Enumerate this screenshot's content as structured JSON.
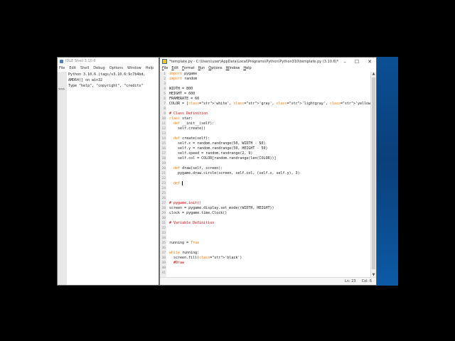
{
  "shell": {
    "title": "IDLE Shell 3.10.6",
    "menu": [
      "File",
      "Edit",
      "Shell",
      "Debug",
      "Options",
      "Window",
      "Help"
    ],
    "output_lines": [
      "Python 3.10.6 (tags/v3.10.6:9c7b4bd,",
      "AMD64)] on win32",
      "Type \"help\", \"copyright\", \"credits\""
    ],
    "prompt": ">>>"
  },
  "editor": {
    "title": "*template.py - C:\\Users\\user\\AppData\\Local\\Programs\\Python\\Python310\\template.py (3.10.6)*",
    "menu": [
      "File",
      "Edit",
      "Format",
      "Run",
      "Options",
      "Window",
      "Help"
    ],
    "window_buttons": [
      "–",
      "☐",
      "✕"
    ],
    "code": [
      {
        "n": "1",
        "t": "import pygame"
      },
      {
        "n": "2",
        "t": "import random"
      },
      {
        "n": "3",
        "t": ""
      },
      {
        "n": "4",
        "t": "WIDTH = 800"
      },
      {
        "n": "5",
        "t": "HEIGHT = 600"
      },
      {
        "n": "6",
        "t": "FRAMERATE = 60"
      },
      {
        "n": "7",
        "t": "COLOR = ['white', 'gray', 'lightgray', 'yellow', 'lightyellow']"
      },
      {
        "n": "8",
        "t": ""
      },
      {
        "n": "9",
        "t": "# Class Definition"
      },
      {
        "n": "10",
        "t": "class star:"
      },
      {
        "n": "11",
        "t": "  def __init__(self):"
      },
      {
        "n": "12",
        "t": "    self.create()"
      },
      {
        "n": "13",
        "t": ""
      },
      {
        "n": "14",
        "t": "  def create(self):"
      },
      {
        "n": "15",
        "t": "    self.x = random.randrange(50, WIDTH - 50)"
      },
      {
        "n": "16",
        "t": "    self.y = random.randrange(50, HEIGHT - 50)"
      },
      {
        "n": "17",
        "t": "    self.speed = random.randrange(2, 9)"
      },
      {
        "n": "18",
        "t": "    self.col = COLOR[random.randrange(len(COLOR))]"
      },
      {
        "n": "19",
        "t": ""
      },
      {
        "n": "20",
        "t": "  def draw(self, screen):"
      },
      {
        "n": "21",
        "t": "    pygame.draw.circle(screen, self.col, (self.x, self.y), 3)"
      },
      {
        "n": "22",
        "t": ""
      },
      {
        "n": "23",
        "t": "  def "
      },
      {
        "n": "24",
        "t": ""
      },
      {
        "n": "25",
        "t": ""
      },
      {
        "n": "26",
        "t": ""
      },
      {
        "n": "27",
        "t": "# pygame.init()"
      },
      {
        "n": "28",
        "t": "screen = pygame.display.set_mode((WIDTH, HEIGHT))"
      },
      {
        "n": "29",
        "t": "clock = pygame.time.Clock()"
      },
      {
        "n": "30",
        "t": ""
      },
      {
        "n": "31",
        "t": "# Variable Definition"
      },
      {
        "n": "32",
        "t": ""
      },
      {
        "n": "33",
        "t": ""
      },
      {
        "n": "34",
        "t": ""
      },
      {
        "n": "35",
        "t": "running = True"
      },
      {
        "n": "36",
        "t": ""
      },
      {
        "n": "37",
        "t": "while running:"
      },
      {
        "n": "38",
        "t": "  screen.fill('black')"
      },
      {
        "n": "39",
        "t": "  #Draw"
      },
      {
        "n": "40",
        "t": ""
      },
      {
        "n": "41",
        "t": ""
      }
    ],
    "status": {
      "line": "Ln: 23",
      "col": "Col: 6"
    }
  },
  "colors": {
    "keyword": "#ff7700",
    "string": "#00aa00",
    "comment": "#dd0000",
    "desktop": "#0b4f93"
  }
}
